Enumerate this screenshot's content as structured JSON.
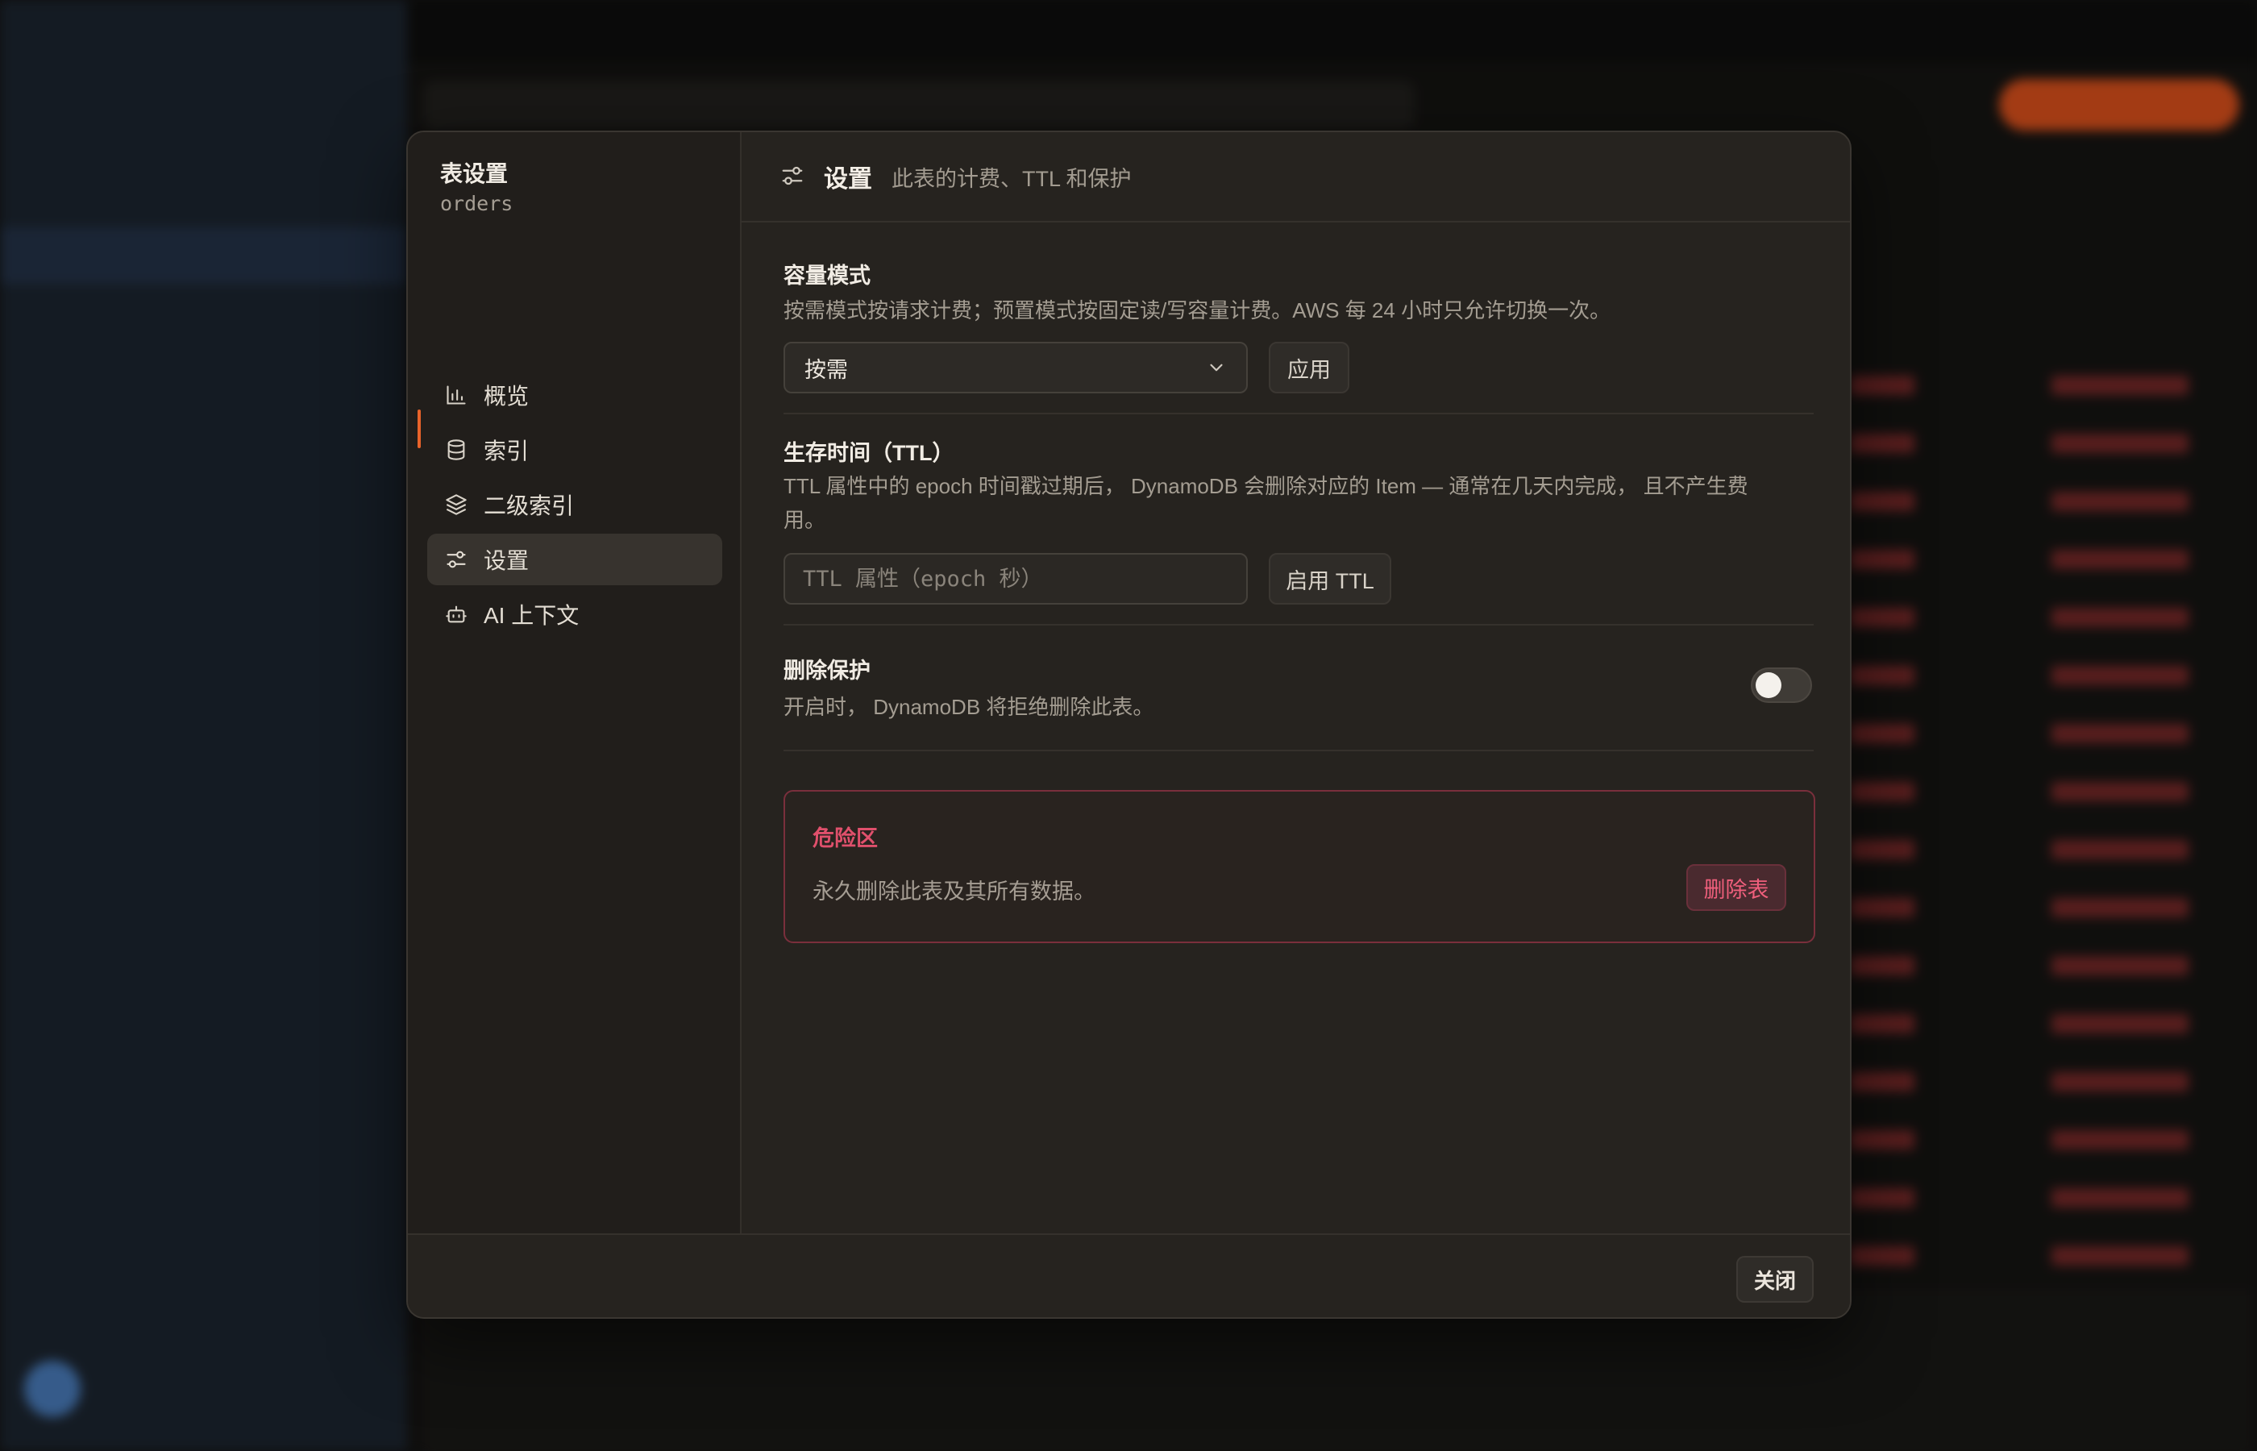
{
  "modal": {
    "nav_title": "表设置",
    "table_name": "orders",
    "nav_items": [
      {
        "label": "概览",
        "icon": "bar-chart-icon"
      },
      {
        "label": "索引",
        "icon": "database-icon"
      },
      {
        "label": "二级索引",
        "icon": "layers-icon"
      },
      {
        "label": "设置",
        "icon": "sliders-icon",
        "active": true
      },
      {
        "label": "AI 上下文",
        "icon": "bot-icon"
      }
    ],
    "header": {
      "title": "设置",
      "description": "此表的计费、TTL 和保护"
    },
    "capacity": {
      "title": "容量模式",
      "description": "按需模式按请求计费；预置模式按固定读/写容量计费。AWS 每 24 小时只允许切换一次。",
      "selected": "按需",
      "apply_label": "应用"
    },
    "ttl": {
      "title": "生存时间（TTL）",
      "description": "TTL 属性中的 epoch 时间戳过期后， DynamoDB 会删除对应的 Item — 通常在几天内完成， 且不产生费用。",
      "placeholder": "TTL 属性（epoch 秒）",
      "enable_label": "启用 TTL"
    },
    "protection": {
      "title": "删除保护",
      "description": "开启时， DynamoDB 将拒绝删除此表。",
      "enabled": false
    },
    "danger": {
      "title": "危险区",
      "description": "永久删除此表及其所有数据。",
      "delete_label": "删除表"
    },
    "close_label": "关闭"
  },
  "colors": {
    "accent": "#e8632a",
    "danger": "#e0506c",
    "modal_bg": "#26231f"
  }
}
